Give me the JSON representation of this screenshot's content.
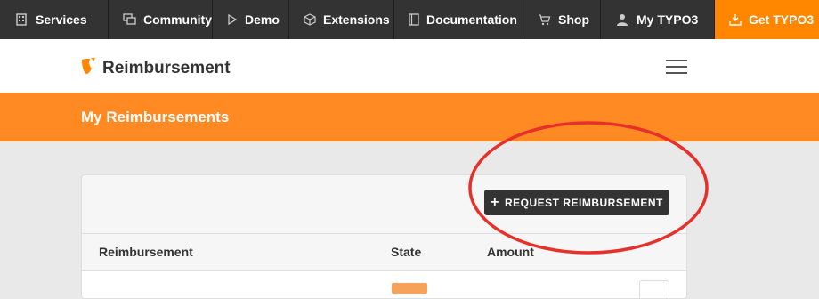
{
  "topnav": {
    "items": [
      {
        "label": "Services",
        "icon": "building-icon"
      },
      {
        "label": "Community",
        "icon": "chat-icon"
      },
      {
        "label": "Demo",
        "icon": "play-icon"
      },
      {
        "label": "Extensions",
        "icon": "cube-icon"
      },
      {
        "label": "Documentation",
        "icon": "book-icon"
      },
      {
        "label": "Shop",
        "icon": "cart-icon"
      },
      {
        "label": "My TYPO3",
        "icon": "user-icon"
      },
      {
        "label": "Get TYPO3",
        "icon": "download-icon"
      }
    ]
  },
  "header": {
    "site_title": "Reimbursement",
    "logo_icon": "typo3-logo-icon",
    "menu_icon": "hamburger-menu-icon"
  },
  "banner": {
    "title": "My Reimbursements"
  },
  "card": {
    "request_button_label": "REQUEST REIMBURSEMENT",
    "table": {
      "columns": [
        "Reimbursement",
        "State",
        "Amount"
      ]
    }
  },
  "colors": {
    "topbar": "#333333",
    "accent": "#ff8700",
    "banner": "#ff8a24",
    "annotation": "#e8302a"
  }
}
